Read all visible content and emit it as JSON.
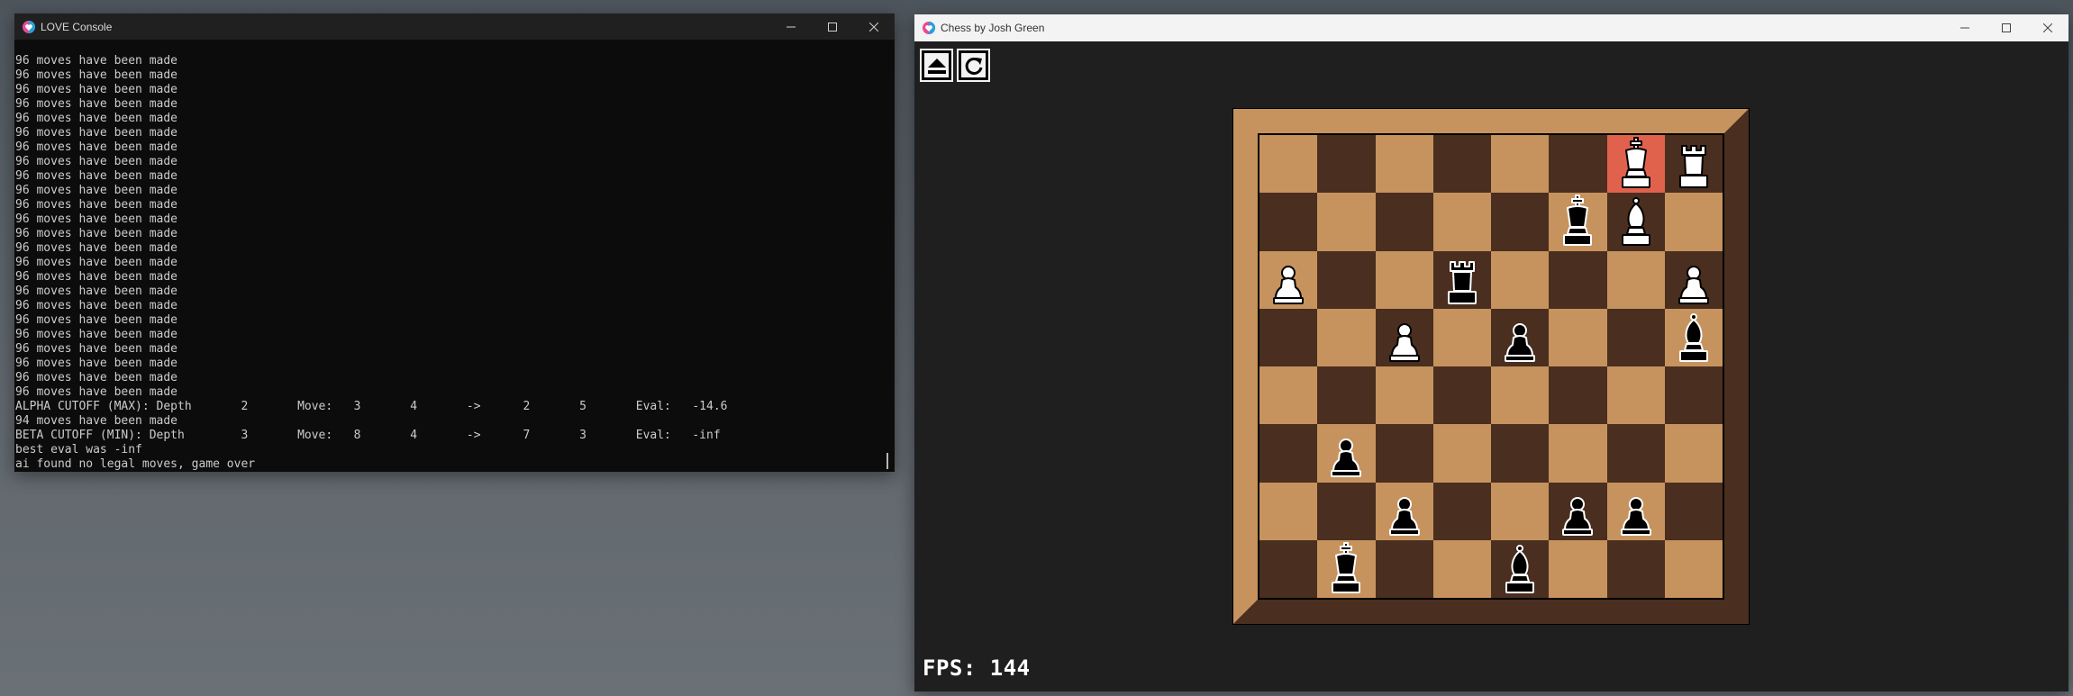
{
  "console": {
    "title": "LOVE Console",
    "lines": [
      "96 moves have been made",
      "96 moves have been made",
      "96 moves have been made",
      "96 moves have been made",
      "96 moves have been made",
      "96 moves have been made",
      "96 moves have been made",
      "96 moves have been made",
      "96 moves have been made",
      "96 moves have been made",
      "96 moves have been made",
      "96 moves have been made",
      "96 moves have been made",
      "96 moves have been made",
      "96 moves have been made",
      "96 moves have been made",
      "96 moves have been made",
      "96 moves have been made",
      "96 moves have been made",
      "96 moves have been made",
      "96 moves have been made",
      "96 moves have been made",
      "96 moves have been made",
      "96 moves have been made",
      "ALPHA CUTOFF (MAX): Depth       2       Move:   3       4       ->      2       5       Eval:   -14.6",
      "94 moves have been made",
      "BETA CUTOFF (MIN): Depth        3       Move:   8       4       ->      7       3       Eval:   -inf",
      "best eval was -inf",
      "ai found no legal moves, game over"
    ]
  },
  "game": {
    "title": "Chess by Josh Green",
    "eject_button": "eject-icon",
    "reset_button": "reset-icon",
    "fps_label": "FPS: 144",
    "highlight_square": "g8",
    "colors": {
      "light": "#c6935e",
      "dark": "#4a2e1f",
      "highlight": "#e0624c"
    },
    "board": [
      [
        "",
        "",
        "",
        "",
        "",
        "",
        "wK",
        "wR"
      ],
      [
        "",
        "",
        "",
        "",
        "",
        "bK",
        "wB",
        ""
      ],
      [
        "wP",
        "",
        "",
        "bR",
        "",
        "",
        "",
        "wP"
      ],
      [
        "",
        "",
        "wP",
        "",
        "bP",
        "",
        "",
        "bB"
      ],
      [
        "",
        "",
        "",
        "",
        "",
        "",
        "",
        ""
      ],
      [
        "",
        "bP",
        "",
        "",
        "",
        "",
        "",
        ""
      ],
      [
        "",
        "",
        "bP",
        "",
        "",
        "bP",
        "bP",
        ""
      ],
      [
        "",
        "bK",
        "",
        "",
        "bB",
        "",
        "",
        ""
      ]
    ]
  },
  "window_controls": [
    "minimize-icon",
    "maximize-icon",
    "close-icon"
  ]
}
